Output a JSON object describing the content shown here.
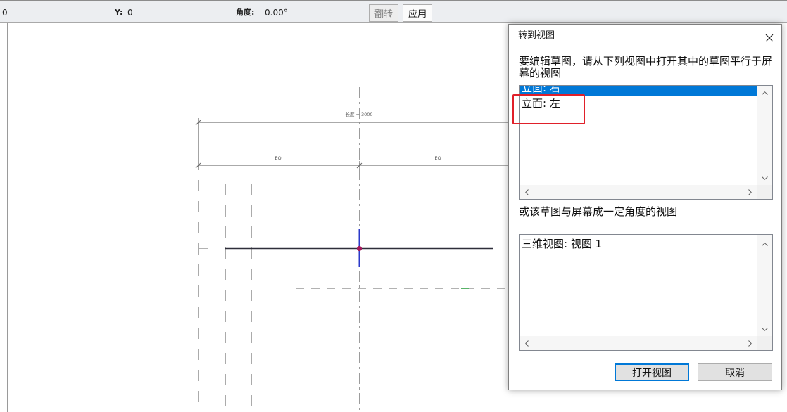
{
  "toolbar": {
    "x_value": "0",
    "y_label": "Y:",
    "y_value": "0",
    "angle_label": "角度:",
    "angle_value": "0.00°",
    "flip_label": "翻转",
    "apply_label": "应用"
  },
  "canvas": {
    "dimension_total": "长度 = 3000",
    "dimension_eq_left": "EQ",
    "dimension_eq_right": "EQ"
  },
  "dialog": {
    "title": "转到视图",
    "instruction": "要编辑草图，请从下列视图中打开其中的草图平行于屏幕的视图",
    "parallel_views": [
      "立面: 右",
      "立面: 左"
    ],
    "selected_parallel_index": 0,
    "angled_prompt": "或该草图与屏幕成一定角度的视图",
    "angled_views": [
      "三维视图: 视图 1"
    ],
    "open_button": "打开视图",
    "cancel_button": "取消"
  },
  "icons": {
    "close": "close-icon",
    "scroll_up": "chevron-up-icon",
    "scroll_down": "chevron-down-icon",
    "scroll_left": "chevron-left-icon",
    "scroll_right": "chevron-right-icon"
  },
  "colors": {
    "selection": "#0078d7",
    "annotation": "#e0202a",
    "default_button_border": "#0078d7",
    "sketch_line": "#2e2e3a",
    "center_point": "#a3195b",
    "direction_marker": "#2b39c9",
    "alignment_mark": "#58b368"
  }
}
